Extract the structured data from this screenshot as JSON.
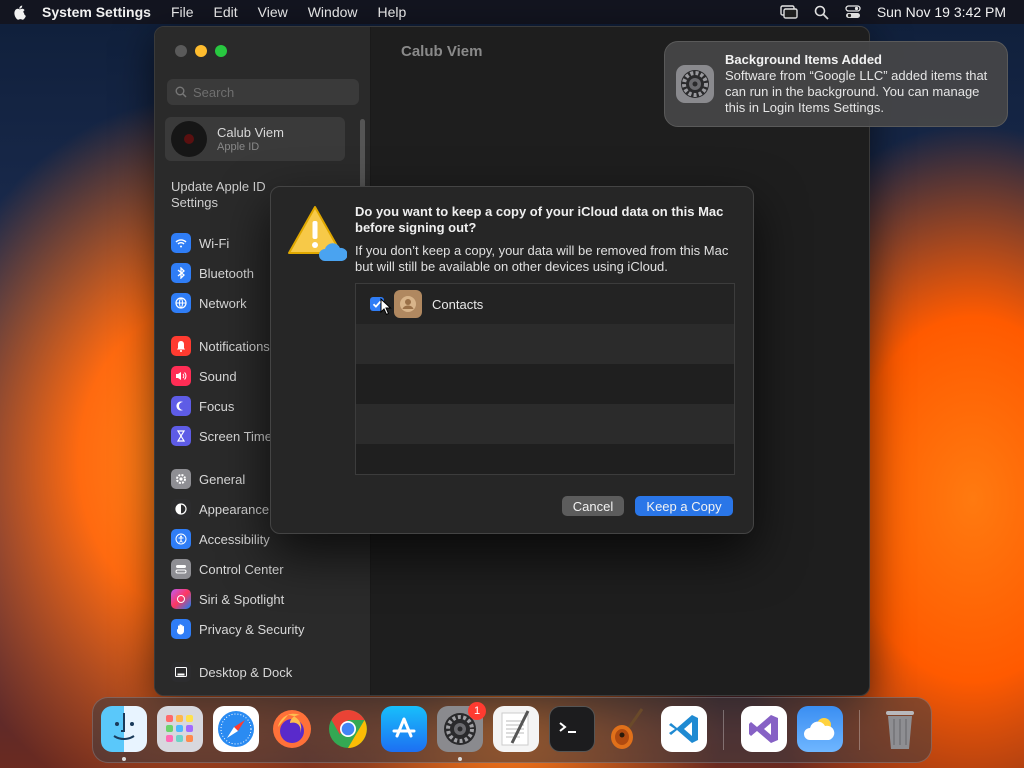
{
  "menubar": {
    "app_name": "System Settings",
    "items": [
      "File",
      "Edit",
      "View",
      "Window",
      "Help"
    ],
    "clock": "Sun Nov 19  3:42 PM"
  },
  "window": {
    "content_title": "Calub Viem",
    "search_placeholder": "Search",
    "account": {
      "name": "Calub Viem",
      "subtitle": "Apple ID"
    },
    "update_text": "Update Apple ID Settings",
    "sidebar": [
      {
        "label": "Wi-Fi",
        "icon": "wifi-icon",
        "color": "#2f7df6"
      },
      {
        "label": "Bluetooth",
        "icon": "bluetooth-icon",
        "color": "#2f7df6"
      },
      {
        "label": "Network",
        "icon": "network-icon",
        "color": "#2f7df6"
      },
      {
        "label": "Notifications",
        "icon": "bell-icon",
        "color": "#ff3b30"
      },
      {
        "label": "Sound",
        "icon": "speaker-icon",
        "color": "#ff2d55"
      },
      {
        "label": "Focus",
        "icon": "moon-icon",
        "color": "#5e5ce6"
      },
      {
        "label": "Screen Time",
        "icon": "hourglass-icon",
        "color": "#5e5ce6"
      },
      {
        "label": "General",
        "icon": "gear-icon",
        "color": "#8e8e93"
      },
      {
        "label": "Appearance",
        "icon": "appearance-icon",
        "color": "#2c2c2e"
      },
      {
        "label": "Accessibility",
        "icon": "accessibility-icon",
        "color": "#2f7df6"
      },
      {
        "label": "Control Center",
        "icon": "control-center-icon",
        "color": "#8e8e93"
      },
      {
        "label": "Siri & Spotlight",
        "icon": "siri-icon",
        "color": "#bf5af2"
      },
      {
        "label": "Privacy & Security",
        "icon": "hand-icon",
        "color": "#2f7df6"
      },
      {
        "label": "Desktop & Dock",
        "icon": "dock-icon",
        "color": "#2c2c2e"
      }
    ]
  },
  "dialog": {
    "title": "Do you want to keep a copy of your iCloud data on this Mac before signing out?",
    "message": "If you don’t keep a copy, your data will be removed from this Mac but will still be available on other devices using iCloud.",
    "items": [
      {
        "label": "Contacts",
        "checked": true
      }
    ],
    "cancel_label": "Cancel",
    "confirm_label": "Keep a Copy"
  },
  "notification": {
    "title": "Background Items Added",
    "body": "Software from “Google LLC” added items that can run in the background. You can manage this in Login Items Settings."
  },
  "dock": {
    "apps": [
      "Finder",
      "Launchpad",
      "Safari",
      "Firefox",
      "Chrome",
      "App Store",
      "System Settings",
      "TextEdit",
      "Terminal",
      "GarageBand",
      "Visual Studio Code",
      "Visual Studio",
      "Weather",
      "Trash"
    ],
    "settings_badge": "1"
  }
}
